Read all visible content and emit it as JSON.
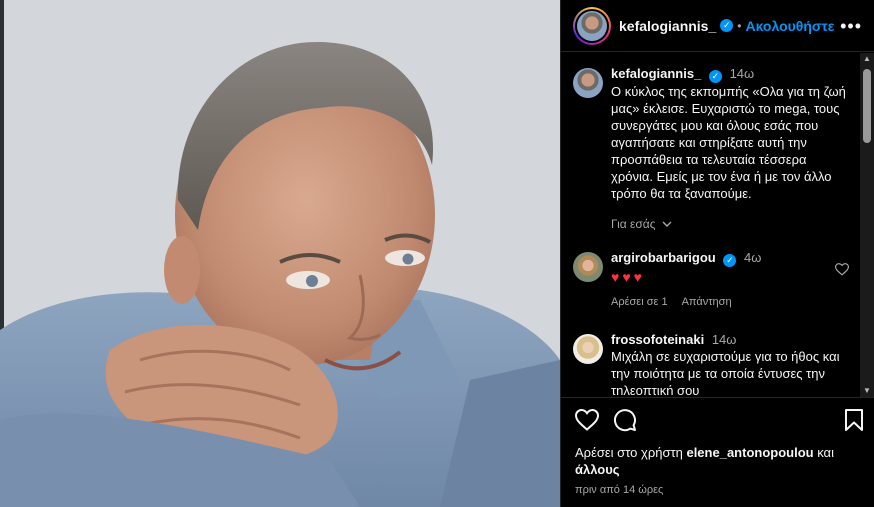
{
  "header": {
    "username": "kefalogiannis_",
    "separator": "•",
    "follow_label": "Ακολουθήστε",
    "more_label": "•••"
  },
  "caption": {
    "username": "kefalogiannis_",
    "time": "14ω",
    "text": "Ο κύκλος της εκπομπής «Ολα για τη ζωή μας» έκλεισε. Ευχαριστώ το mega, τους συνεργάτες μου και όλους εσάς που αγαπήσατε και στηρίξατε αυτή την προσπάθεια τα τελευταία τέσσερα χρόνια. Εμείς με τον ένα ή με τον άλλο τρόπο θα τα ξαναπούμε.",
    "for_you_label": "Για εσάς"
  },
  "comments": [
    {
      "username": "argirobarbarigou",
      "time": "4ω",
      "text": "♥♥♥",
      "likes_label": "Αρέσει σε 1",
      "reply_label": "Απάντηση"
    },
    {
      "username": "frossofoteinaki",
      "time": "14ω",
      "text": "Μιχάλη σε ευχαριστούμε για το ήθος και την ποιότητα με τα οποία έντυσες την τηλεοπτική σου"
    }
  ],
  "likes": {
    "prefix": "Αρέσει στο χρήστη",
    "user": "elene_antonopoulou",
    "connector": "και",
    "others": "άλλους"
  },
  "posted_ago": "πριν από 14 ώρες",
  "icons": {
    "verified": "verified-badge-icon",
    "like": "heart-outline-icon",
    "comment": "speech-bubble-icon",
    "save": "bookmark-icon",
    "chevron": "chevron-down-icon"
  },
  "colors": {
    "accent": "#0095f6",
    "heart": "#ff3040",
    "secondary_text": "#a8a8a8",
    "background": "#000000"
  }
}
